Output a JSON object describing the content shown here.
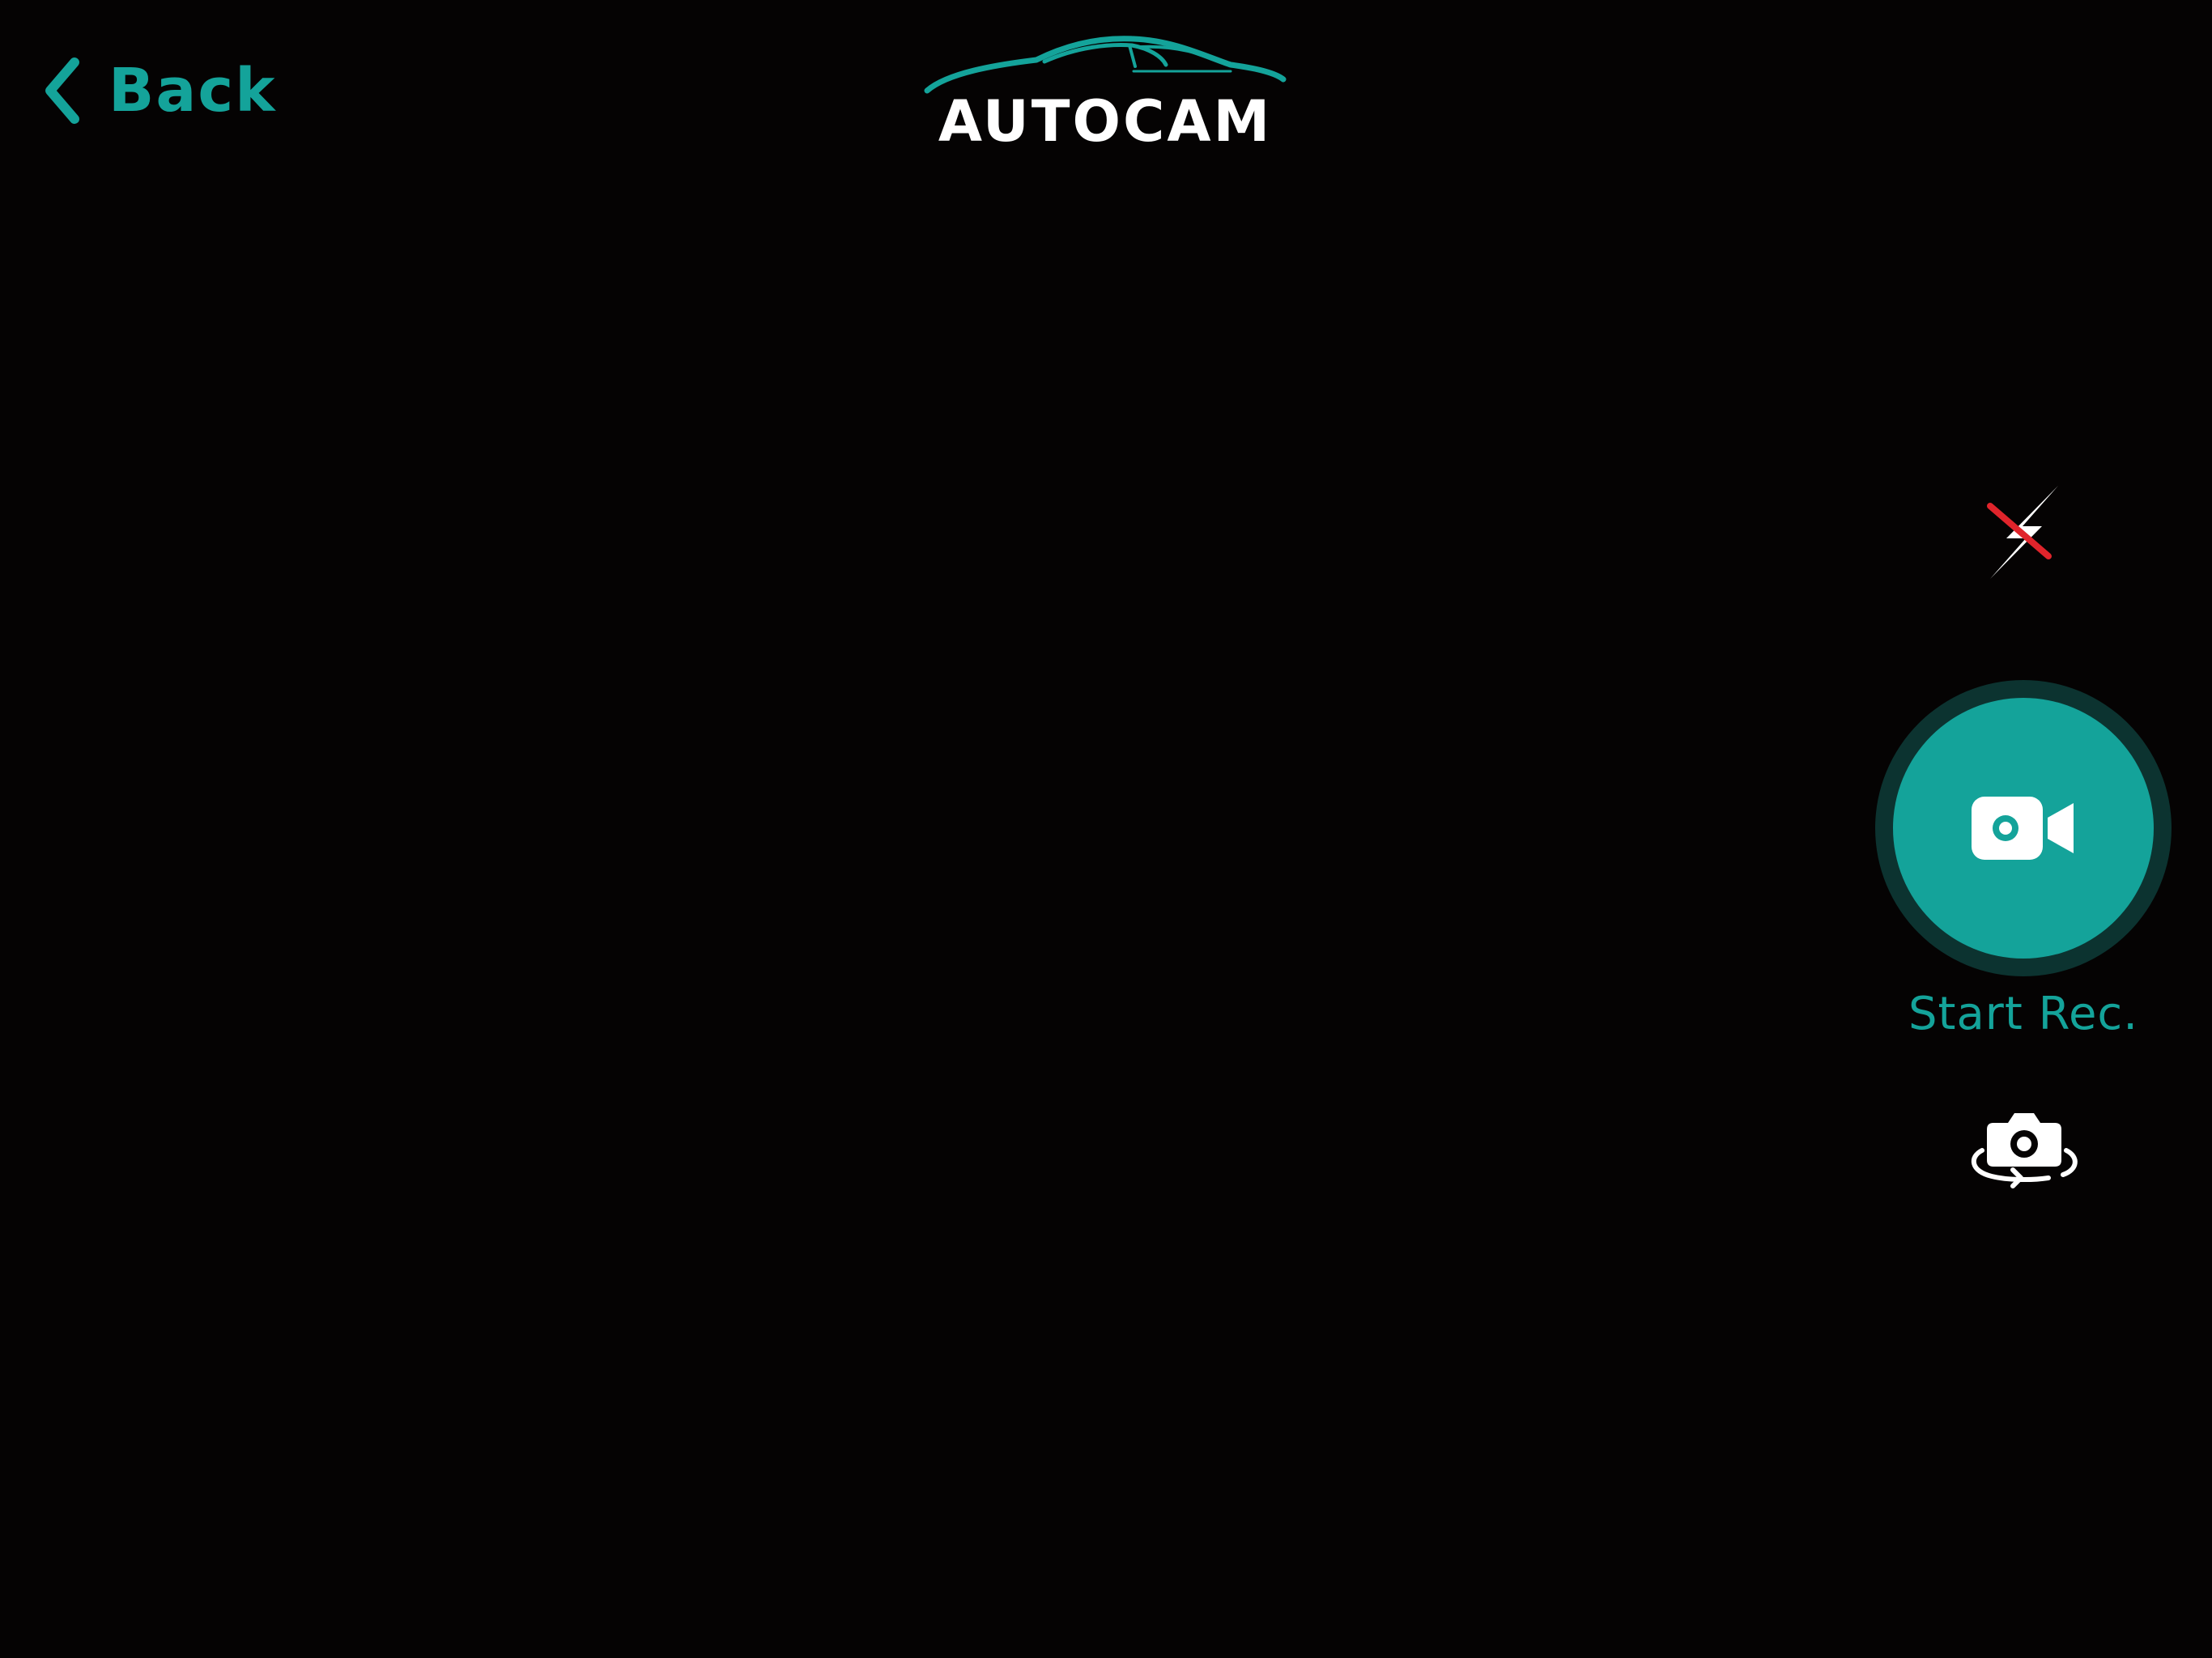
{
  "header": {
    "back_label": "Back",
    "logo_text": "AUTOCAM"
  },
  "controls": {
    "flash_state": "off",
    "record_label": "Start Rec."
  },
  "icons": {
    "back": "chevron-left-icon",
    "flash": "flash-off-icon",
    "record": "video-camera-icon",
    "switch_camera": "camera-rotate-icon"
  },
  "colors": {
    "accent": "#14A39A",
    "accent_dark_ring": "#0C3330",
    "background": "#050303",
    "flash_off_slash": "#E0242B",
    "icon_white": "#FFFFFF"
  }
}
